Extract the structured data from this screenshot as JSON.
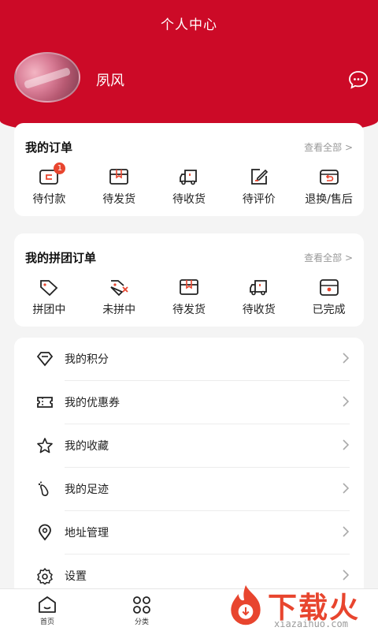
{
  "header": {
    "title": "个人中心",
    "username": "夙风"
  },
  "orders": {
    "title": "我的订单",
    "more": "查看全部 >",
    "items": [
      {
        "label": "待付款",
        "icon": "wallet-icon",
        "badge": "1"
      },
      {
        "label": "待发货",
        "icon": "package-icon"
      },
      {
        "label": "待收货",
        "icon": "truck-icon"
      },
      {
        "label": "待评价",
        "icon": "edit-icon"
      },
      {
        "label": "退换/售后",
        "icon": "return-icon"
      }
    ]
  },
  "group_orders": {
    "title": "我的拼团订单",
    "more": "查看全部 >",
    "items": [
      {
        "label": "拼团中",
        "icon": "tag-icon"
      },
      {
        "label": "未拼中",
        "icon": "tag-x-icon"
      },
      {
        "label": "待发货",
        "icon": "package-icon"
      },
      {
        "label": "待收货",
        "icon": "truck-icon"
      },
      {
        "label": "已完成",
        "icon": "done-box-icon"
      }
    ]
  },
  "menu": [
    {
      "label": "我的积分",
      "icon": "diamond-icon"
    },
    {
      "label": "我的优惠券",
      "icon": "ticket-icon"
    },
    {
      "label": "我的收藏",
      "icon": "star-icon"
    },
    {
      "label": "我的足迹",
      "icon": "footprint-icon"
    },
    {
      "label": "地址管理",
      "icon": "location-icon"
    },
    {
      "label": "设置",
      "icon": "gear-icon"
    }
  ],
  "tabbar": [
    {
      "label": "首页",
      "icon": "home-icon"
    },
    {
      "label": "分类",
      "icon": "category-icon"
    }
  ],
  "watermark": {
    "text": "下载火",
    "sub": "xiazaihuo.com"
  },
  "colors": {
    "brand": "#cc0a27",
    "badge": "#e8452e",
    "watermark": "#e8452e"
  }
}
